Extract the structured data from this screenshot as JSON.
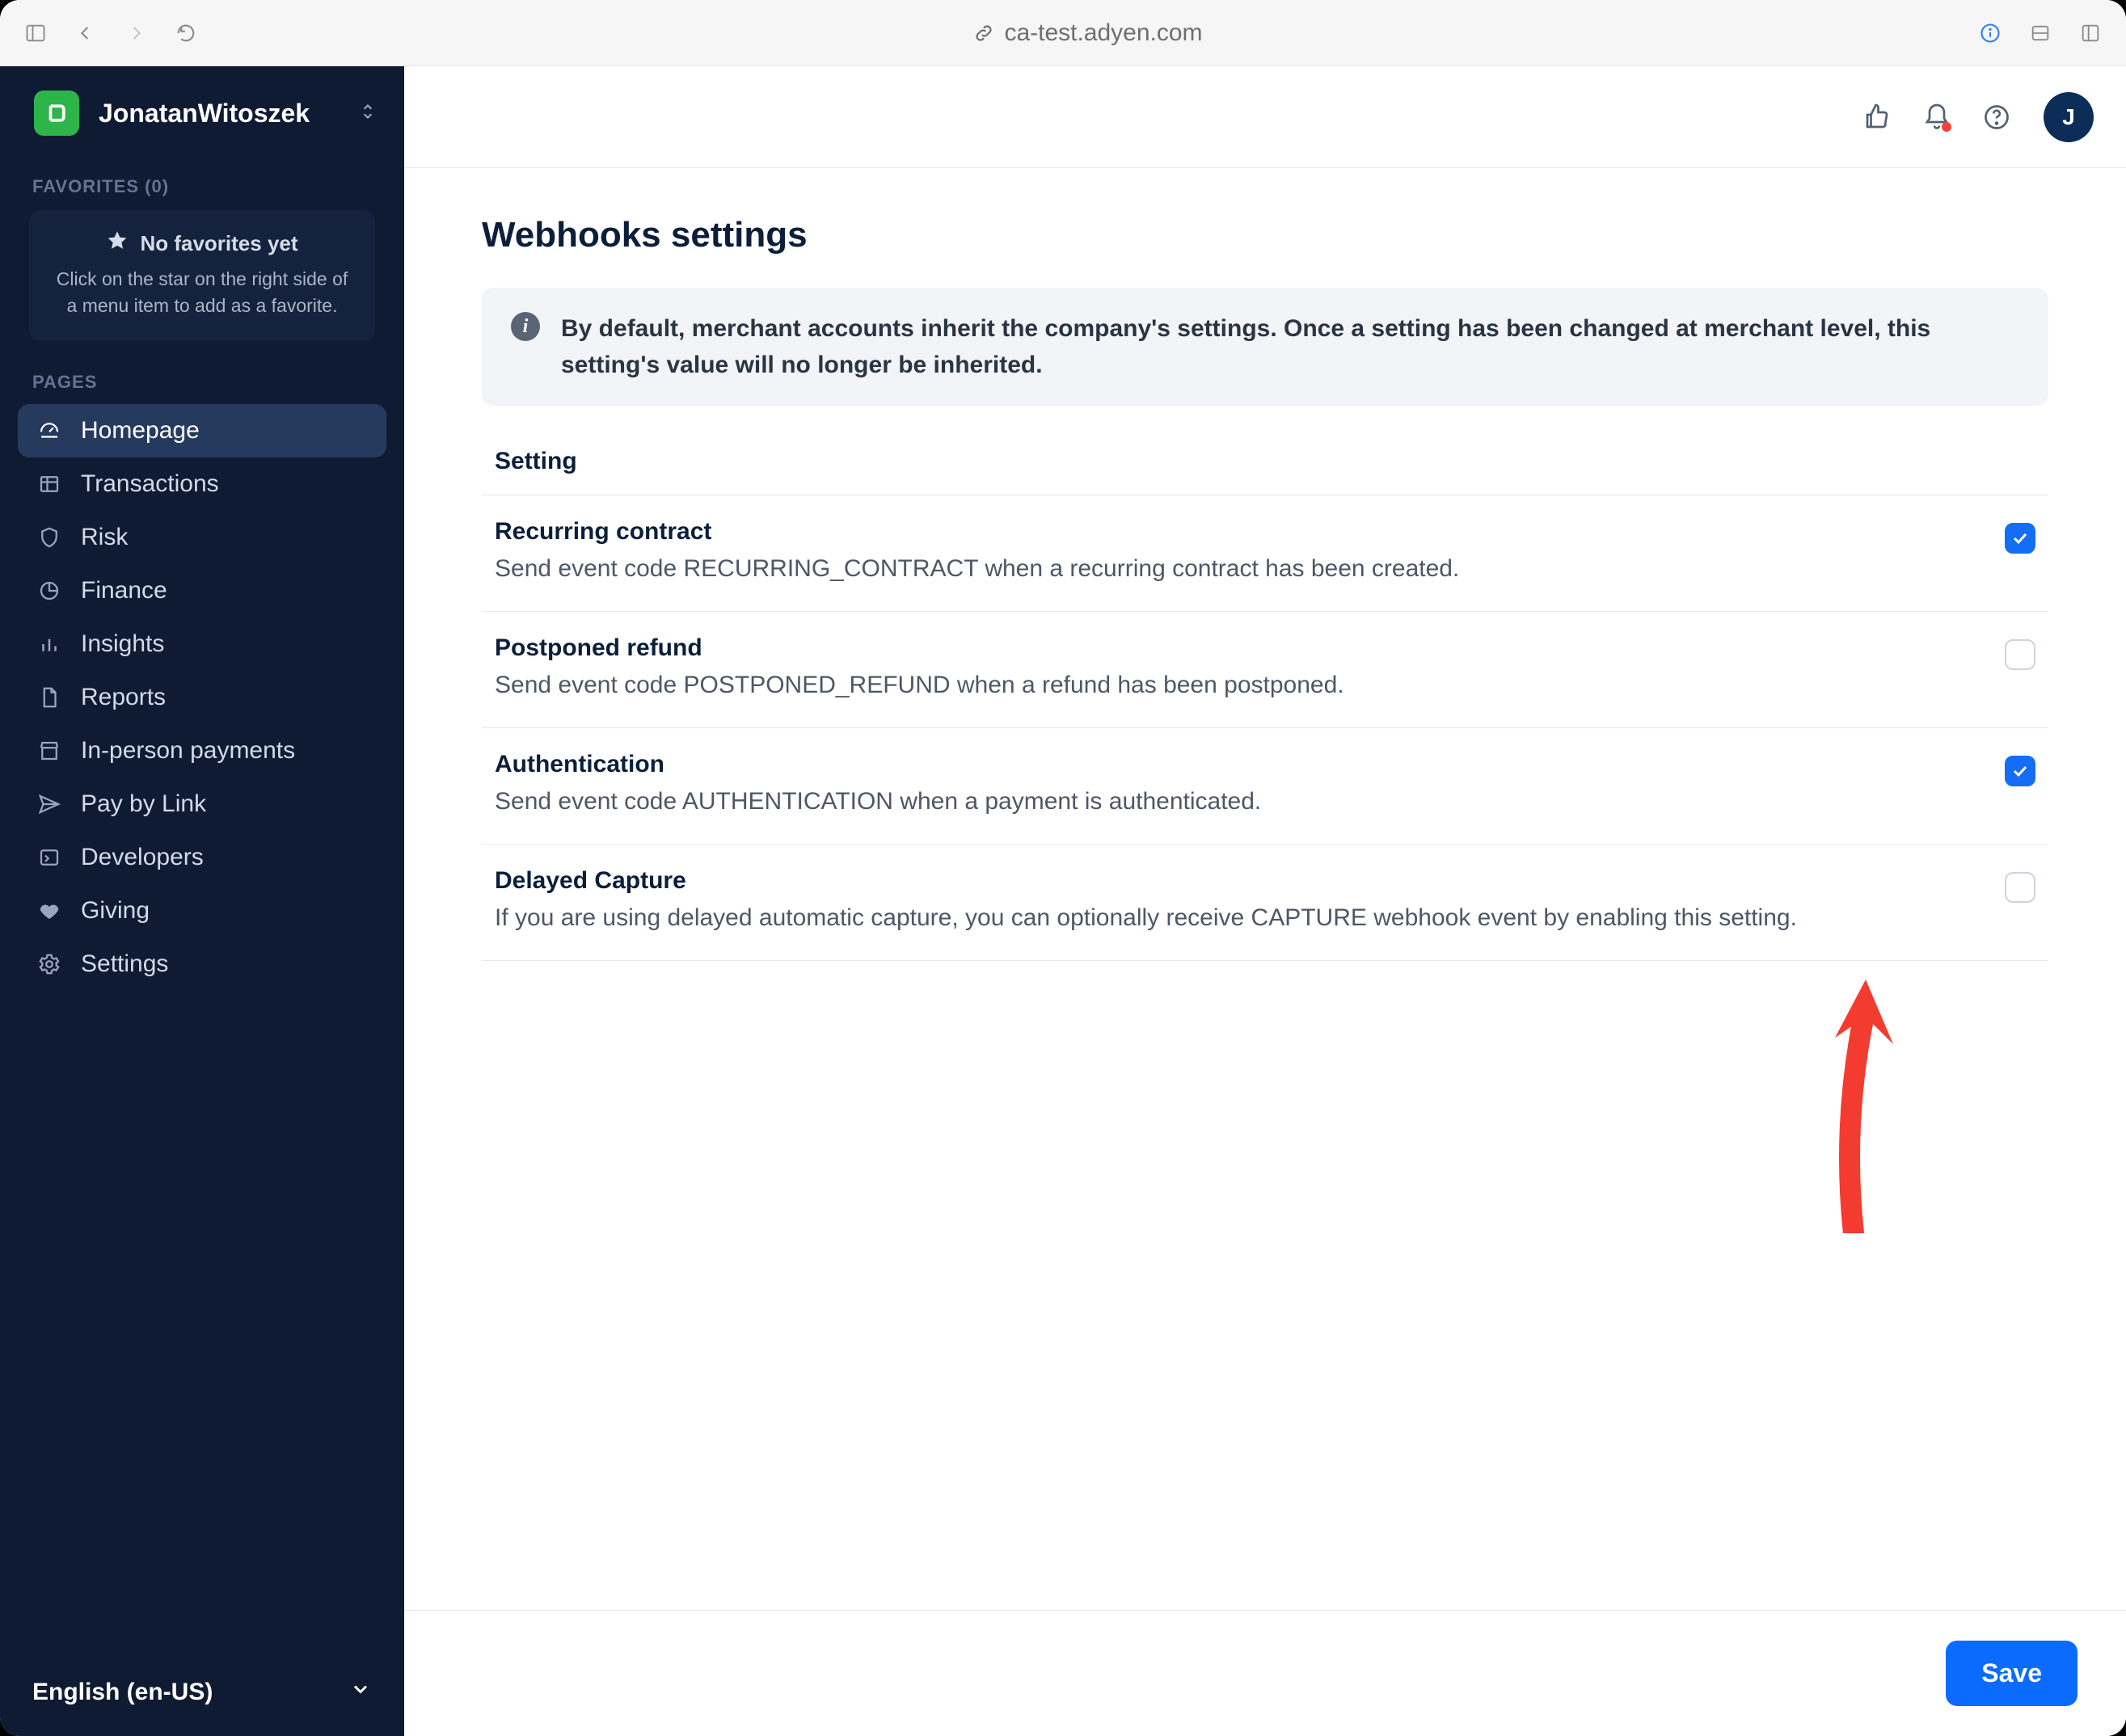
{
  "browser": {
    "url": "ca-test.adyen.com"
  },
  "sidebar": {
    "account_name": "JonatanWitoszek",
    "sections": {
      "favorites_label": "FAVORITES (0)",
      "favorites_empty_title": "No favorites yet",
      "favorites_empty_sub": "Click on the star on the right side of a menu item to add as a favorite.",
      "pages_label": "PAGES"
    },
    "nav": [
      {
        "key": "homepage",
        "label": "Homepage",
        "icon": "gauge",
        "active": true
      },
      {
        "key": "transactions",
        "label": "Transactions",
        "icon": "table"
      },
      {
        "key": "risk",
        "label": "Risk",
        "icon": "shield"
      },
      {
        "key": "finance",
        "label": "Finance",
        "icon": "doughnut"
      },
      {
        "key": "insights",
        "label": "Insights",
        "icon": "bars"
      },
      {
        "key": "reports",
        "label": "Reports",
        "icon": "file"
      },
      {
        "key": "in-person",
        "label": "In-person payments",
        "icon": "store"
      },
      {
        "key": "paybylink",
        "label": "Pay by Link",
        "icon": "send"
      },
      {
        "key": "developers",
        "label": "Developers",
        "icon": "terminal"
      },
      {
        "key": "giving",
        "label": "Giving",
        "icon": "heart"
      },
      {
        "key": "settings",
        "label": "Settings",
        "icon": "gear"
      }
    ],
    "language": "English (en-US)"
  },
  "topbar": {
    "avatar_initial": "J"
  },
  "page": {
    "title": "Webhooks settings",
    "info_banner": "By default, merchant accounts inherit the company's settings. Once a setting has been changed at merchant level, this setting's value will no longer be inherited.",
    "column_header": "Setting",
    "rows": [
      {
        "title": "Recurring contract",
        "desc": "Send event code RECURRING_CONTRACT when a recurring contract has been created.",
        "checked": true
      },
      {
        "title": "Postponed refund",
        "desc": "Send event code POSTPONED_REFUND when a refund has been postponed.",
        "checked": false
      },
      {
        "title": "Authentication",
        "desc": "Send event code AUTHENTICATION when a payment is authenticated.",
        "checked": true
      },
      {
        "title": "Delayed Capture",
        "desc": "If you are using delayed automatic capture, you can optionally receive CAPTURE webhook event by enabling this setting.",
        "checked": false
      }
    ],
    "save_label": "Save"
  }
}
